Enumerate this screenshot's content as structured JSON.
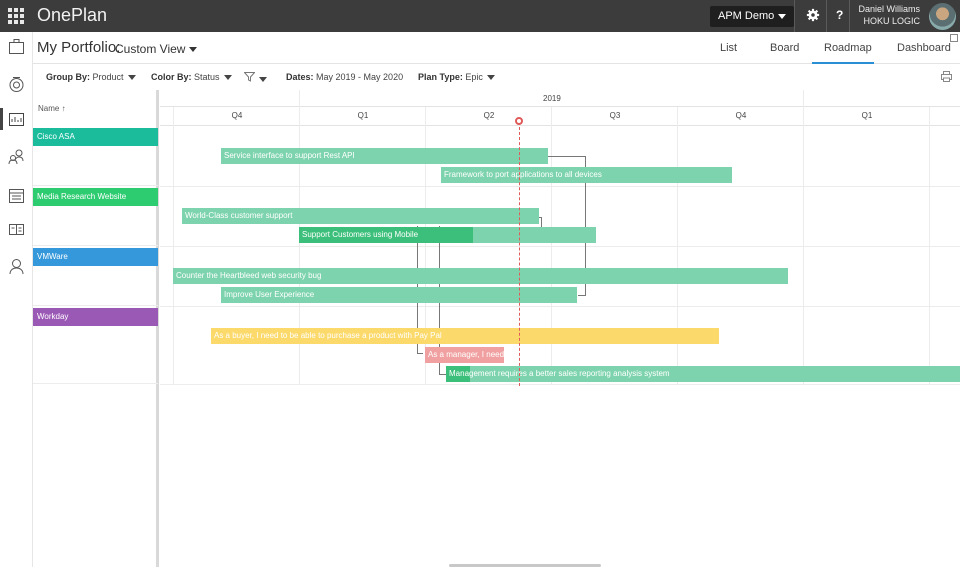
{
  "app": {
    "title": "OnePlan"
  },
  "topbar": {
    "environment": "APM Demo",
    "user_name": "Daniel Williams",
    "user_org": "HOKU LOGIC",
    "help_label": "?"
  },
  "header": {
    "portfolio_title": "My Portfolio:",
    "view_name": "Custom View",
    "tabs": [
      {
        "label": "List"
      },
      {
        "label": "Board"
      },
      {
        "label": "Roadmap",
        "active": true
      },
      {
        "label": "Dashboard"
      }
    ]
  },
  "filters": {
    "group_by_label": "Group By:",
    "group_by_value": "Product",
    "color_by_label": "Color By:",
    "color_by_value": "Status",
    "dates_label": "Dates:",
    "dates_value": "May 2019 - May 2020",
    "plan_type_label": "Plan Type:",
    "plan_type_value": "Epic"
  },
  "name_column": {
    "header": "Name",
    "sort_icon": "arrow-up-icon"
  },
  "timeline": {
    "year": "2019",
    "quarters": [
      "Q4",
      "Q1",
      "Q2",
      "Q3",
      "Q4",
      "Q1"
    ]
  },
  "groups": [
    {
      "name": "Cisco ASA",
      "color": "#1abc9c"
    },
    {
      "name": "Media Research Website",
      "color": "#2ecc71"
    },
    {
      "name": "VMWare",
      "color": "#3498db"
    },
    {
      "name": "Workday",
      "color": "#9b59b6"
    }
  ],
  "bars": [
    {
      "label": "Service interface to support Rest API",
      "color": "#7dd3ad"
    },
    {
      "label": "Framework to port applications to all devices",
      "color": "#7dd3ad"
    },
    {
      "label": "World-Class customer support",
      "color": "#7dd3ad"
    },
    {
      "label": "Support Customers using Mobile",
      "color": "#7dd3ad",
      "progress_color": "#3cbf7a"
    },
    {
      "label": "Counter the Heartbleed web security bug",
      "color": "#7dd3ad"
    },
    {
      "label": "Improve User Experience",
      "color": "#7dd3ad"
    },
    {
      "label": "As a buyer, I need to be able to purchase a product with Pay Pal",
      "color": "#fcd96b"
    },
    {
      "label": "As a manager, I need",
      "color": "#f0a0a0"
    },
    {
      "label": "Management requires a better sales reporting analysis system",
      "color": "#7dd3ad",
      "progress_color": "#3cbf7a"
    }
  ],
  "colors": {
    "topbar": "#3c3c3c",
    "accent": "#2b8fd6",
    "today": "#e05a5a"
  }
}
